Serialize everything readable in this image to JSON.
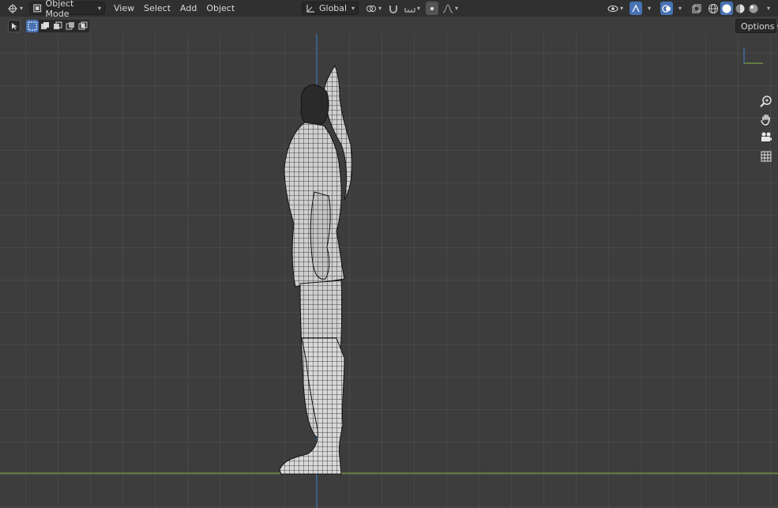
{
  "header": {
    "editor_type_icon": "editor-type-icon",
    "mode": "Object Mode",
    "menus": [
      "View",
      "Select",
      "Add",
      "Object"
    ],
    "transform_orientation": "Global",
    "options_label": "Options"
  },
  "toolbar": {
    "active_tool_icon": "select-box-icon",
    "selection_modes": [
      "set",
      "extend",
      "subtract",
      "invert",
      "intersect"
    ]
  },
  "viewport": {
    "background": "#3d3d3d",
    "grid_color": "#545454",
    "x_axis_color": "#7da045",
    "z_axis_color": "#3f76b8",
    "view": "right-orthographic",
    "navigation": [
      "zoom-icon",
      "hand-pan-icon",
      "camera-icon",
      "grid-icon"
    ]
  },
  "accent": "#4772b3"
}
